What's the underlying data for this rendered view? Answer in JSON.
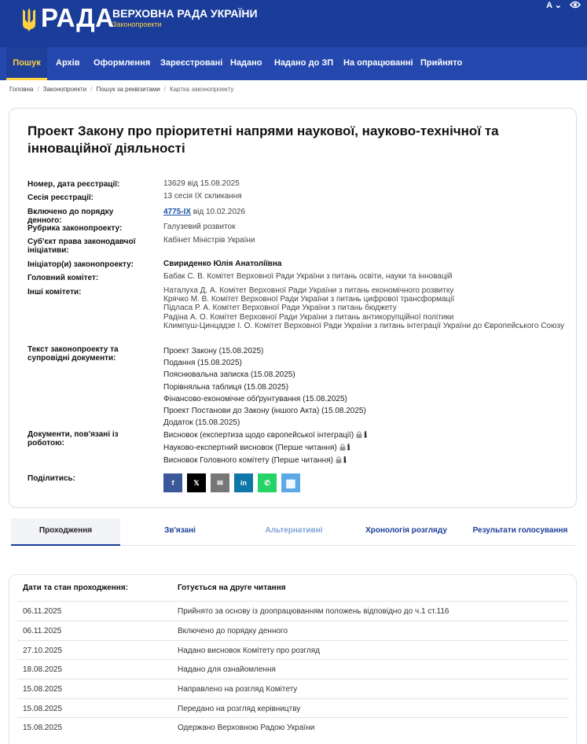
{
  "header": {
    "logo_text": "РАДА",
    "title": "ВЕРХОВНА РАДА УКРАЇНИ",
    "subtitle": "Законопроекти",
    "font_toggle": "A",
    "font_chevron": "⌄",
    "icons": [
      "trident-icon",
      "eye-icon"
    ]
  },
  "nav": {
    "items": [
      "Пошук",
      "Архів",
      "Оформлення",
      "Зареєстровані",
      "Надано",
      "Надано до ЗП",
      "На опрацюванні",
      "Прийнято"
    ],
    "active": "Пошук"
  },
  "breadcrumb": [
    "Головна",
    "Законопроекти",
    "Пошук за реквізитами",
    "Картка законопроекту"
  ],
  "bill": {
    "title": "Проект Закону про пріоритетні напрями наукової, науково-технічної та інноваційної діяльності",
    "fields": {
      "number_label": "Номер, дата реєстрації:",
      "number_value": "13629 від 15.08.2025",
      "session_label": "Сесія реєстрації:",
      "session_value": "13 сесія IX скликання",
      "agenda_label": "Включено до порядку денного:",
      "agenda_link": "4775-IX",
      "agenda_date": " від 10.02.2026",
      "rubric_label": "Рубрика законопроекту:",
      "rubric_value": "Галузевий розвиток",
      "subject_label": "Суб'єкт права законодавчої ініціативи:",
      "subject_value": "Кабінет Міністрів України",
      "initiator_label": "Ініціатор(и) законопроекту:",
      "initiator_value": "Свириденко Юлія Анатоліївна",
      "main_committee_label": "Головний комітет:",
      "main_committee_value": "Бабак С. В. Комітет Верховної Ради України з питань освіти, науки та інновацій",
      "other_committees_label": "Інші комітети:",
      "other_committees": "Наталуха Д. А. Комітет Верховної Ради України з питань економічного розвитку\nКрячко М. В. Комітет Верховної Ради України з питань цифрової трансформації\nПідласа Р. А. Комітет Верховної Ради України з питань бюджету\nРадіна А. О. Комітет Верховної Ради України з питань антикорупційної політики\nКлимпуш-Цинцадзе І. О. Комітет Верховної Ради України з питань інтеграції України до Європейського Союзу",
      "docs_label": "Текст законопроекту та супровідні документи:",
      "docs": [
        "Проект Закону (15.08.2025)",
        "Подання (15.08.2025)",
        "Пояснювальна записка (15.08.2025)",
        "Порівняльна таблиця (15.08.2025)",
        "Фінансово-економічне обґрунтування (15.08.2025)",
        "Проект Постанови до Закону (іншого Акта) (15.08.2025)",
        "Додаток (15.08.2025)"
      ],
      "work_docs_label": "Документи, пов'язані із роботою:",
      "work_docs": [
        "Висновок (експертиза щодо європейської інтеграції)",
        "Науково-експертний висновок (Перше читання)",
        "Висновок Головного комітету (Перше читання)"
      ],
      "info_glyph": "ℹ",
      "share_label": "Поділитись:"
    },
    "share_buttons": [
      {
        "name": "facebook",
        "glyph": "f",
        "color": "#3b5998"
      },
      {
        "name": "x",
        "glyph": "𝕏",
        "color": "#000000"
      },
      {
        "name": "email",
        "glyph": "✉",
        "color": "#777777"
      },
      {
        "name": "linkedin",
        "glyph": "in",
        "color": "#0e76a8"
      },
      {
        "name": "whatsapp",
        "glyph": "✆",
        "color": "#25d366"
      },
      {
        "name": "qr",
        "glyph": "▦",
        "color": "#5ca9e6"
      }
    ]
  },
  "tabs": {
    "items": [
      "Проходження",
      "Зв'язані",
      "Альтернативні",
      "Хронологія розгляду",
      "Результати голосування"
    ],
    "active": "Проходження"
  },
  "passage": {
    "header_date": "Дати та стан проходження:",
    "header_status": "Готується на друге читання",
    "rows": [
      {
        "date": "06.11.2025",
        "text": "Прийнято за основу із доопрацюванням положень відповідно до ч.1 ст.116"
      },
      {
        "date": "06.11.2025",
        "text": "Включено до порядку денного"
      },
      {
        "date": "27.10.2025",
        "text": "Надано висновок Комітету про розгляд"
      },
      {
        "date": "18.08.2025",
        "text": "Надано для ознайомлення"
      },
      {
        "date": "15.08.2025",
        "text": "Направлено на розгляд Комітету"
      },
      {
        "date": "15.08.2025",
        "text": "Передано на розгляд керівництву"
      },
      {
        "date": "15.08.2025",
        "text": "Одержано Верховною Радою України"
      }
    ]
  },
  "colors": {
    "header": "#1b3d9a",
    "nav": "#2448ad",
    "accent": "#ffd23f",
    "link": "#1b4fa3"
  }
}
